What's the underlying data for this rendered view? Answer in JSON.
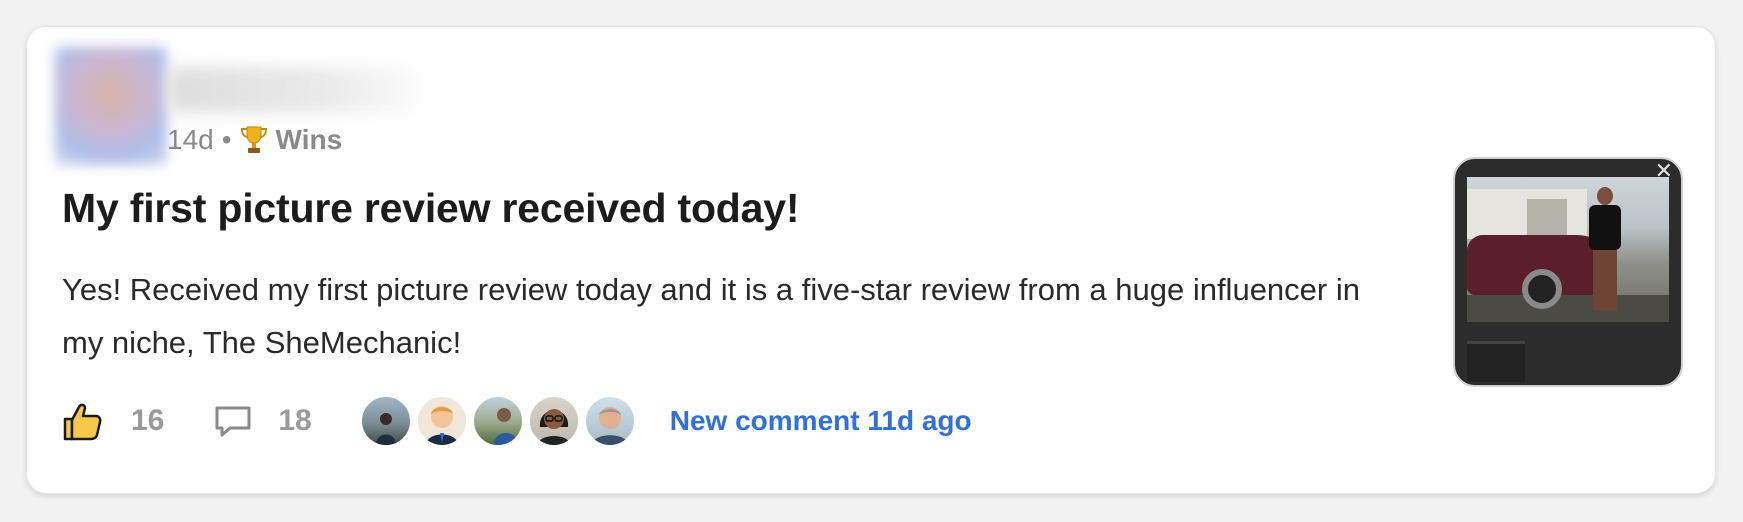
{
  "post": {
    "age": "14d",
    "separator": "•",
    "category": "Wins",
    "category_icon": "trophy-icon",
    "title": "My first picture review received today!",
    "body": "Yes! Received my first picture review today and it is a five-star review from a huge influencer in my niche, The SheMechanic!"
  },
  "thumbnail": {
    "close_label": "✕"
  },
  "actions": {
    "like_count": "16",
    "comment_count": "18",
    "new_comment_label": "New comment 11d ago"
  },
  "colors": {
    "accent_link": "#2f6fe0",
    "muted_text": "#8a8a8a"
  }
}
